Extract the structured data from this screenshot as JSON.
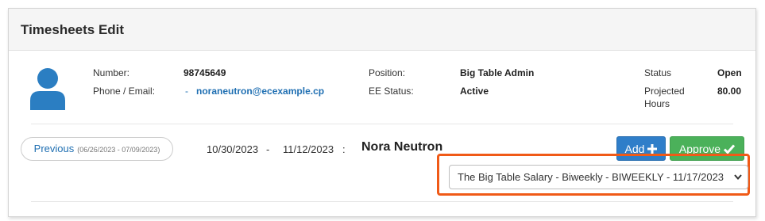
{
  "header": {
    "title": "Timesheets Edit"
  },
  "employee_info": {
    "number_label": "Number:",
    "number_value": "98745649",
    "contact_label": "Phone / Email:",
    "contact_dash": "-",
    "email": "noraneutron@ecexample.cp",
    "position_label": "Position:",
    "position_value": "Big Table Admin",
    "ee_status_label": "EE Status:",
    "ee_status_value": "Active",
    "status_label": "Status",
    "status_value": "Open",
    "projected_label_line1": "Projected",
    "projected_label_line2": "Hours",
    "projected_value": "80.00"
  },
  "period": {
    "previous_label": "Previous",
    "previous_range": "(06/26/2023 - 07/09/2023)",
    "start_date": "10/30/2023",
    "dash": "-",
    "end_date": "11/12/2023",
    "colon": ":",
    "employee_name": "Nora Neutron"
  },
  "actions": {
    "add_label": "Add",
    "approve_label": "Approve"
  },
  "pay_schedule_select": {
    "selected": "The Big Table Salary - Biweekly - BIWEEKLY - 11/17/2023"
  },
  "colors": {
    "link": "#1f6fb2",
    "add_button": "#2f7ec9",
    "approve_button": "#4bb15a",
    "highlight": "#f05a17",
    "avatar": "#2b7ec2"
  },
  "icons": {
    "avatar": "user-silhouette",
    "add": "plus-icon",
    "approve": "check-icon",
    "select": "chevron-down-icon"
  }
}
